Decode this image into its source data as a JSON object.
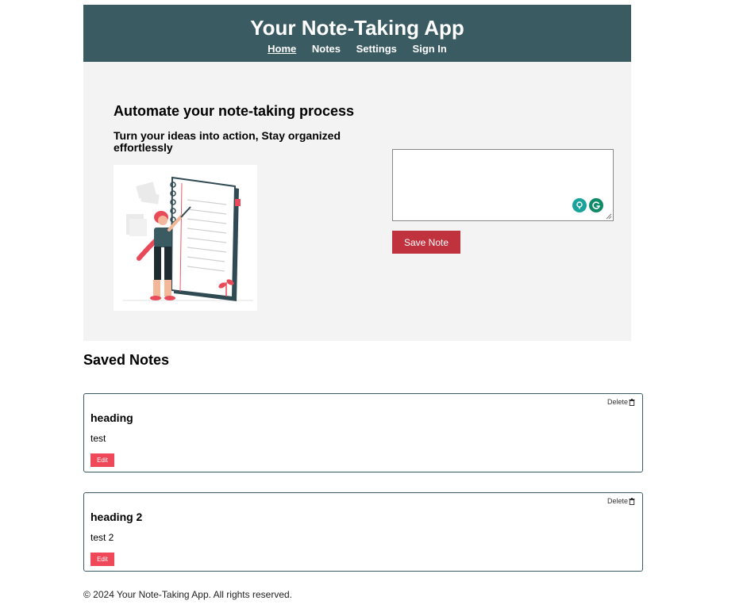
{
  "header": {
    "title": "Your Note-Taking App",
    "nav": [
      "Home",
      "Notes",
      "Settings",
      "Sign In"
    ],
    "bg_color": "#3b5b63"
  },
  "hero": {
    "title": "Automate your note-taking process",
    "subtitle": "Turn your ideas into action, Stay organized effortlessly",
    "illustration": "person-writing-on-notebook-illustration",
    "save_label": "Save Note",
    "save_color": "#c0323e"
  },
  "saved": {
    "title": "Saved Notes",
    "delete_label": "Delete",
    "edit_label": "Edit",
    "notes": [
      {
        "heading": "heading",
        "body": "test"
      },
      {
        "heading": "heading 2",
        "body": "test 2"
      }
    ]
  },
  "footer": "© 2024 Your Note-Taking App. All rights reserved."
}
